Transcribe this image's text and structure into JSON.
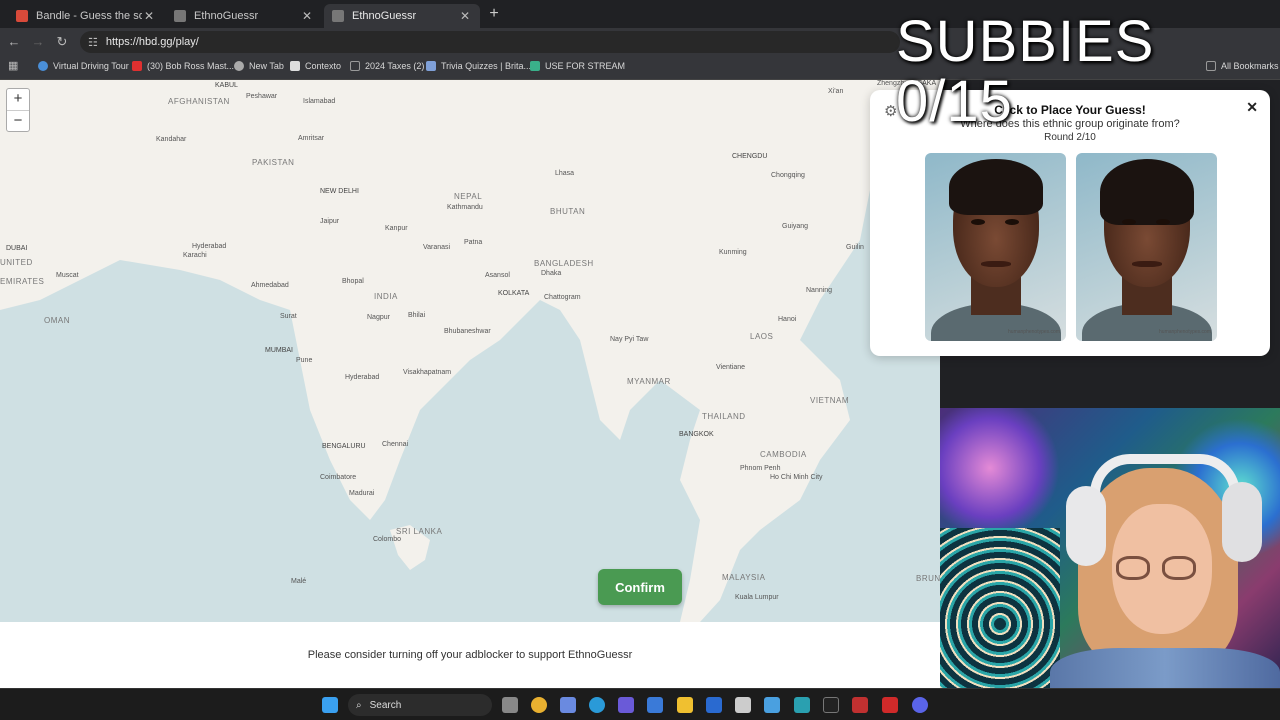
{
  "browser": {
    "tabs": [
      {
        "title": "Bandle - Guess the song, one i",
        "active": false,
        "color": "#d84a3a"
      },
      {
        "title": "EthnoGuessr",
        "active": false,
        "color": "#777777"
      },
      {
        "title": "EthnoGuessr",
        "active": true,
        "color": "#777777"
      }
    ],
    "url": "https://hbd.gg/play/",
    "bookmarks": [
      {
        "label": "Virtual Driving Tour",
        "color": "#4a8fd8"
      },
      {
        "label": "(30) Bob Ross Mast...",
        "color": "#e03030"
      },
      {
        "label": "New Tab",
        "color": "#aaaaaa"
      },
      {
        "label": "Contexto",
        "color": "#dddddd"
      },
      {
        "label": "2024 Taxes (2)",
        "color": "#999999"
      },
      {
        "label": "Trivia Quizzes | Brita...",
        "color": "#7fa0d8"
      },
      {
        "label": "USE FOR STREAM",
        "color": "#3ab08a"
      }
    ],
    "all_bookmarks": "All Bookmarks"
  },
  "overlay": {
    "subbies": "SUBBIES 0/15"
  },
  "map": {
    "zoom_in": "+",
    "zoom_out": "−",
    "countries": [
      "AFGHANISTAN",
      "PAKISTAN",
      "NEPAL",
      "BHUTAN",
      "BANGLADESH",
      "INDIA",
      "OMAN",
      "MYANMAR",
      "LAOS",
      "THAILAND",
      "VIETNAM",
      "CAMBODIA",
      "SRI LANKA",
      "MALAYSIA",
      "BRUN",
      "EMIRATES"
    ],
    "cities": [
      "KABUL",
      "Peshawar",
      "Islamabad",
      "Kandahar",
      "Amritsar",
      "NEW DELHI",
      "Jaipur",
      "Kanpur",
      "Lhasa",
      "Kathmandu",
      "Varanasi",
      "Patna",
      "CHENGDU",
      "Chongqing",
      "Guiyang",
      "Kunming",
      "Nanning",
      "Hanoi",
      "Guilin",
      "DUBAI",
      "Hyderabad",
      "Karachi",
      "Muscat",
      "Ahmedabad",
      "Bhopal",
      "Surat",
      "Nagpur",
      "Bhilai",
      "Asansol",
      "KOLKATA",
      "Chattogram",
      "Dhaka",
      "Bhubaneshwar",
      "MUMBAI",
      "Pune",
      "Hyderabad",
      "Visakhapatnam",
      "Nay Pyi Taw",
      "Vientiane",
      "BANGKOK",
      "BENGALURU",
      "Chennai",
      "Coimbatore",
      "Madurai",
      "Phnom Penh",
      "Ho Chi Minh City",
      "Colombo",
      "Malé",
      "Kuala Lumpur",
      "Zhengzhou",
      "Xi'an",
      "OSAKA",
      "UNITED"
    ],
    "confirm_label": "Confirm"
  },
  "panel": {
    "heading": "Click to Place Your Guess!",
    "question": "Where does this ethnic group originate from?",
    "round": "Round 2/10",
    "face_caption": "humanphenotypes.com",
    "faces": [
      "male-composite-face",
      "female-composite-face"
    ]
  },
  "footer": {
    "adblock_message": "Please consider turning off your adblocker to support EthnoGuessr"
  },
  "taskbar": {
    "search_label": "Search"
  }
}
